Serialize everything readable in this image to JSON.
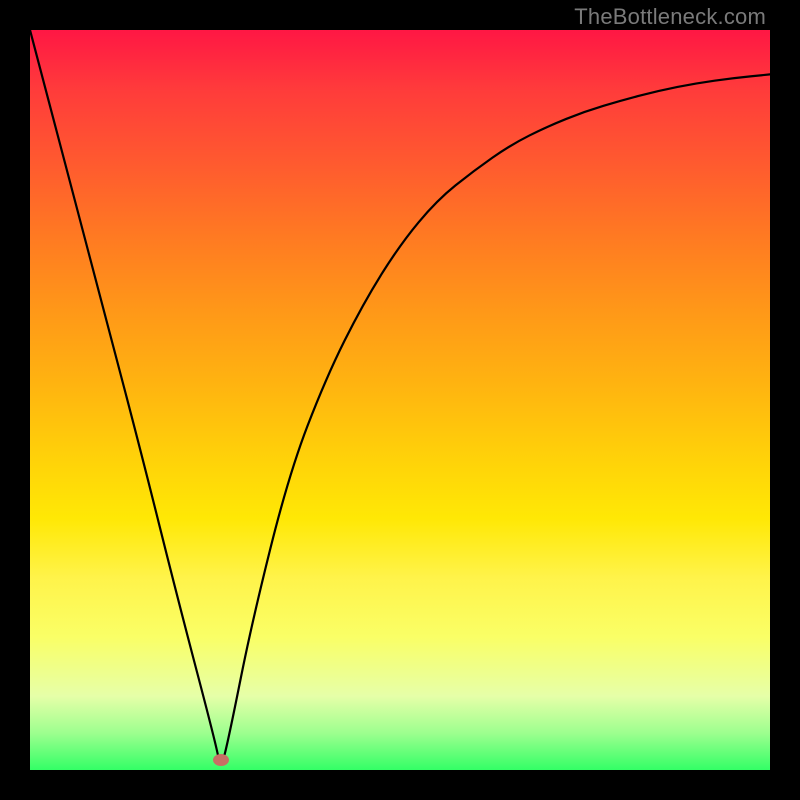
{
  "watermark": "TheBottleneck.com",
  "marker": {
    "x_frac": 0.258,
    "y_frac": 0.987
  },
  "chart_data": {
    "type": "line",
    "title": "",
    "xlabel": "",
    "ylabel": "",
    "xlim": [
      0,
      100
    ],
    "ylim": [
      0,
      100
    ],
    "grid": false,
    "legend": false,
    "series": [
      {
        "name": "curve",
        "x": [
          0,
          5,
          10,
          15,
          20,
          25,
          25.8,
          27,
          30,
          35,
          40,
          45,
          50,
          55,
          60,
          65,
          70,
          75,
          80,
          85,
          90,
          95,
          100
        ],
        "y": [
          100,
          81,
          62,
          43,
          23,
          4,
          0,
          5,
          20,
          40,
          53,
          63,
          71,
          77,
          81,
          84.5,
          87,
          89,
          90.5,
          91.8,
          92.8,
          93.5,
          94
        ]
      }
    ],
    "marker_point": {
      "x": 25.8,
      "y": 0
    },
    "background_gradient": {
      "type": "vertical",
      "stops": [
        {
          "pos": 0,
          "color": "#ff1744"
        },
        {
          "pos": 0.5,
          "color": "#ffb410"
        },
        {
          "pos": 0.82,
          "color": "#faff66"
        },
        {
          "pos": 1,
          "color": "#33ff66"
        }
      ]
    }
  }
}
